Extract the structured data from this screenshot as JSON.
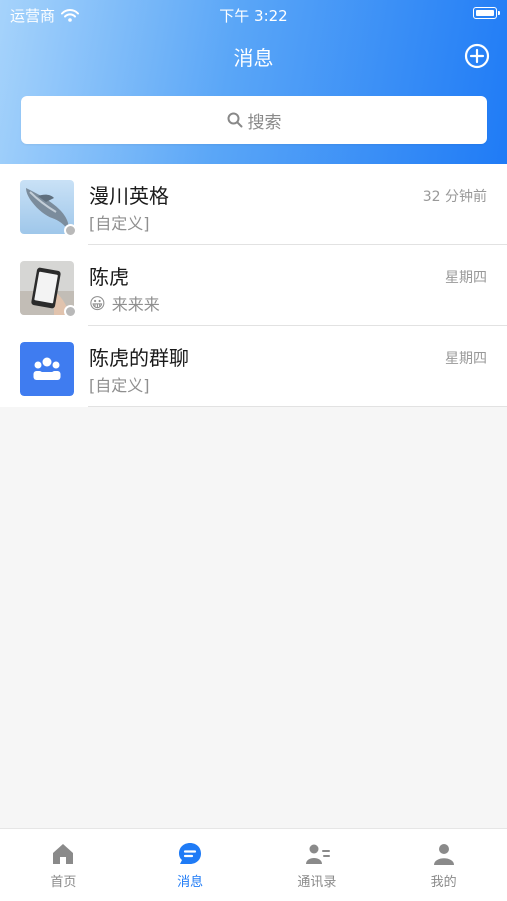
{
  "status_bar": {
    "carrier": "运营商",
    "time": "下午 3:22"
  },
  "header": {
    "title": "消息",
    "add_icon": "plus-circle-icon"
  },
  "search": {
    "placeholder": "搜索",
    "icon": "search-icon"
  },
  "conversations": [
    {
      "name": "漫川英格",
      "time": "32 分钟前",
      "preview": "[自定义]",
      "avatar": "dolphin-photo",
      "online": false
    },
    {
      "name": "陈虎",
      "time": "星期四",
      "preview": "来来来",
      "preview_emoji": "😀",
      "avatar": "phone-photo",
      "online": false
    },
    {
      "name": "陈虎的群聊",
      "time": "星期四",
      "preview": "[自定义]",
      "avatar": "group-icon",
      "online": null
    }
  ],
  "tab_bar": {
    "items": [
      {
        "label": "首页",
        "icon": "home-icon",
        "active": false
      },
      {
        "label": "消息",
        "icon": "chat-icon",
        "active": true
      },
      {
        "label": "通讯录",
        "icon": "contacts-icon",
        "active": false
      },
      {
        "label": "我的",
        "icon": "person-icon",
        "active": false
      }
    ]
  },
  "colors": {
    "accent": "#1f7bf6",
    "group_avatar": "#3f7cf0",
    "inactive": "#8a8a8a"
  }
}
